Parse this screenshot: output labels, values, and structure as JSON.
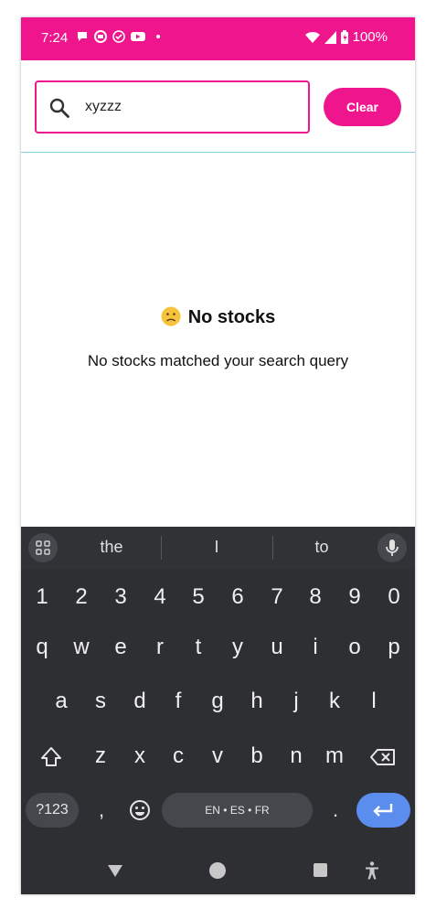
{
  "status_bar": {
    "time": "7:24",
    "battery": "100%"
  },
  "search": {
    "value": "xyzzz",
    "clear_label": "Clear"
  },
  "empty_state": {
    "title": "No stocks",
    "message": "No stocks matched your search query"
  },
  "keyboard": {
    "suggestions": [
      "the",
      "I",
      "to"
    ],
    "number_row": [
      "1",
      "2",
      "3",
      "4",
      "5",
      "6",
      "7",
      "8",
      "9",
      "0"
    ],
    "row1": [
      "q",
      "w",
      "e",
      "r",
      "t",
      "y",
      "u",
      "i",
      "o",
      "p"
    ],
    "row2": [
      "a",
      "s",
      "d",
      "f",
      "g",
      "h",
      "j",
      "k",
      "l"
    ],
    "row3": [
      "z",
      "x",
      "c",
      "v",
      "b",
      "n",
      "m"
    ],
    "symbols_label": "?123",
    "comma": ",",
    "space_label": "EN • ES • FR",
    "period": "."
  },
  "colors": {
    "accent": "#ef168d",
    "keyboard_bg": "#2d2f33",
    "enter_key": "#5b8def"
  },
  "icons": {
    "search": "search-icon",
    "emoji_empty": "frowning-face-icon",
    "mic": "mic-icon",
    "grid": "apps-grid-icon",
    "shift": "shift-icon",
    "backspace": "backspace-icon",
    "enter": "enter-icon",
    "emoji_key": "emoji-icon"
  }
}
